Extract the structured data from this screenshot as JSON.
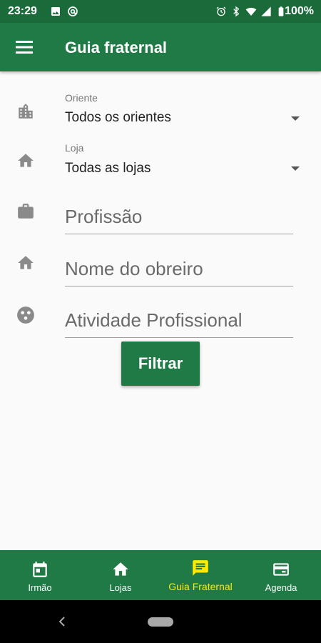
{
  "status_bar": {
    "time": "23:29",
    "battery": "100%",
    "left_icons": [
      "image-icon",
      "at-sign-icon"
    ],
    "right_icons": [
      "alarm-icon",
      "bluetooth-icon",
      "wifi-icon",
      "signal-icon",
      "battery-icon"
    ]
  },
  "app_bar": {
    "title": "Guia fraternal",
    "menu_icon": "menu-icon"
  },
  "form": {
    "oriente": {
      "label": "Oriente",
      "value": "Todos os orientes",
      "icon": "city-icon"
    },
    "loja": {
      "label": "Loja",
      "value": "Todas as lojas",
      "icon": "home-icon"
    },
    "profissao": {
      "placeholder": "Profissão",
      "icon": "briefcase-icon"
    },
    "nome_obreiro": {
      "placeholder": "Nome do obreiro",
      "icon": "home-icon"
    },
    "atividade": {
      "placeholder": "Atividade Profissional",
      "icon": "grain-icon"
    },
    "filter_button": "Filtrar"
  },
  "bottom_nav": {
    "items": [
      {
        "label": "Irmão",
        "icon": "calendar-icon",
        "active": false
      },
      {
        "label": "Lojas",
        "icon": "home-icon",
        "active": false
      },
      {
        "label": "Guia Fraternal",
        "icon": "message-icon",
        "active": true
      },
      {
        "label": "Agenda",
        "icon": "card-icon",
        "active": false
      }
    ]
  },
  "colors": {
    "primary": "#1f7a45",
    "status_bar": "#1b6b3a",
    "active_nav": "#ffeb00",
    "icon_gray": "#8a8a8a"
  }
}
